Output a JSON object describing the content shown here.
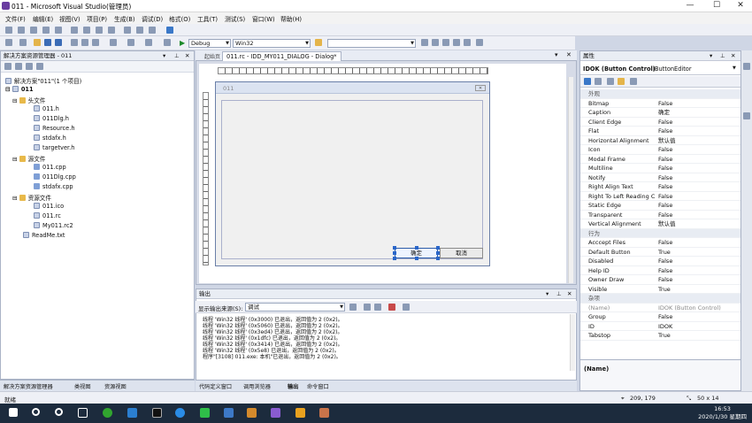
{
  "window": {
    "title": "011 - Microsoft Visual Studio(管理员)",
    "minimize": "—",
    "maximize": "☐",
    "close": "✕"
  },
  "menu": [
    "文件(F)",
    "编辑(E)",
    "视图(V)",
    "项目(P)",
    "生成(B)",
    "调试(D)",
    "格式(O)",
    "工具(T)",
    "测试(S)",
    "窗口(W)",
    "帮助(H)"
  ],
  "toolbar": {
    "config": "Debug",
    "platform": "Win32"
  },
  "solution_explorer": {
    "title": "解决方案资源管理器 - 011",
    "root": "解决方案\"011\"(1 个项目)",
    "project": "011",
    "items": [
      {
        "label": "头文件",
        "kind": "folder"
      },
      {
        "label": "011.h",
        "kind": "file"
      },
      {
        "label": "011Dlg.h",
        "kind": "file"
      },
      {
        "label": "Resource.h",
        "kind": "file"
      },
      {
        "label": "stdafx.h",
        "kind": "file"
      },
      {
        "label": "targetver.h",
        "kind": "file"
      },
      {
        "label": "源文件",
        "kind": "folder"
      },
      {
        "label": "011.cpp",
        "kind": "cpp"
      },
      {
        "label": "011Dlg.cpp",
        "kind": "cpp"
      },
      {
        "label": "stdafx.cpp",
        "kind": "cpp"
      },
      {
        "label": "资源文件",
        "kind": "folder"
      },
      {
        "label": "011.ico",
        "kind": "file"
      },
      {
        "label": "011.rc",
        "kind": "file"
      },
      {
        "label": "My011.rc2",
        "kind": "file"
      },
      {
        "label": "ReadMe.txt",
        "kind": "file"
      }
    ],
    "tabs": [
      "解决方案资源管理器",
      "类视图",
      "资源视图"
    ]
  },
  "document": {
    "tab": "011.rc - IDD_MY011_DIALOG - Dialog*",
    "start_tab": "起始页",
    "dialog_title": "011",
    "dialog_close": "✕",
    "ok_label": "确定",
    "cancel_label": "取消"
  },
  "output": {
    "title": "输出",
    "source_label": "显示输出来源(S):",
    "source_value": "调试",
    "lines": [
      "线程 'Win32 线程' (0x3000) 已退出，返回值为 2 (0x2)。",
      "线程 'Win32 线程' (0x5060) 已退出，返回值为 2 (0x2)。",
      "线程 'Win32 线程' (0x3ed4) 已退出，返回值为 2 (0x2)。",
      "线程 'Win32 线程' (0x1dfc) 已退出，返回值为 2 (0x2)。",
      "线程 'Win32 线程' (0x3414) 已退出，返回值为 2 (0x2)。",
      "线程 'Win32 线程' (0x5e8) 已退出，返回值为 2 (0x2)。",
      "程序\"[3108] 011.exe: 本机\"已退出，返回值为 2 (0x2)。"
    ],
    "tabs": [
      "代码定义窗口",
      "调用浏览器",
      "输出",
      "命令窗口"
    ]
  },
  "properties": {
    "title": "属性",
    "selected": "IDOK (Button Control)",
    "selected_type": "IButtonEditor",
    "rows": [
      {
        "cat": "外观"
      },
      {
        "name": "Bitmap",
        "value": "False"
      },
      {
        "name": "Caption",
        "value": "确定"
      },
      {
        "name": "Client Edge",
        "value": "False"
      },
      {
        "name": "Flat",
        "value": "False"
      },
      {
        "name": "Horizontal Alignment",
        "value": "默认值"
      },
      {
        "name": "Icon",
        "value": "False"
      },
      {
        "name": "Modal Frame",
        "value": "False"
      },
      {
        "name": "Multiline",
        "value": "False"
      },
      {
        "name": "Notify",
        "value": "False"
      },
      {
        "name": "Right Align Text",
        "value": "False"
      },
      {
        "name": "Right To Left Reading C",
        "value": "False"
      },
      {
        "name": "Static Edge",
        "value": "False"
      },
      {
        "name": "Transparent",
        "value": "False"
      },
      {
        "name": "Vertical Alignment",
        "value": "默认值"
      },
      {
        "cat": "行为"
      },
      {
        "name": "Acccept Files",
        "value": "False"
      },
      {
        "name": "Default Button",
        "value": "True"
      },
      {
        "name": "Disabled",
        "value": "False"
      },
      {
        "name": "Help ID",
        "value": "False"
      },
      {
        "name": "Owner Draw",
        "value": "False"
      },
      {
        "name": "Visible",
        "value": "True"
      },
      {
        "cat": "杂项"
      },
      {
        "name": "(Name)",
        "value": "IDOK (Button Control)"
      },
      {
        "name": "Group",
        "value": "False"
      },
      {
        "name": "ID",
        "value": "IDOK"
      },
      {
        "name": "Tabstop",
        "value": "True"
      }
    ],
    "desc_title": "(Name)"
  },
  "status": {
    "left": "就绪",
    "pos": "209, 179",
    "size": "50 x 14"
  },
  "taskbar": {
    "time": "16:53",
    "date": "2020/1/30 星期四"
  }
}
